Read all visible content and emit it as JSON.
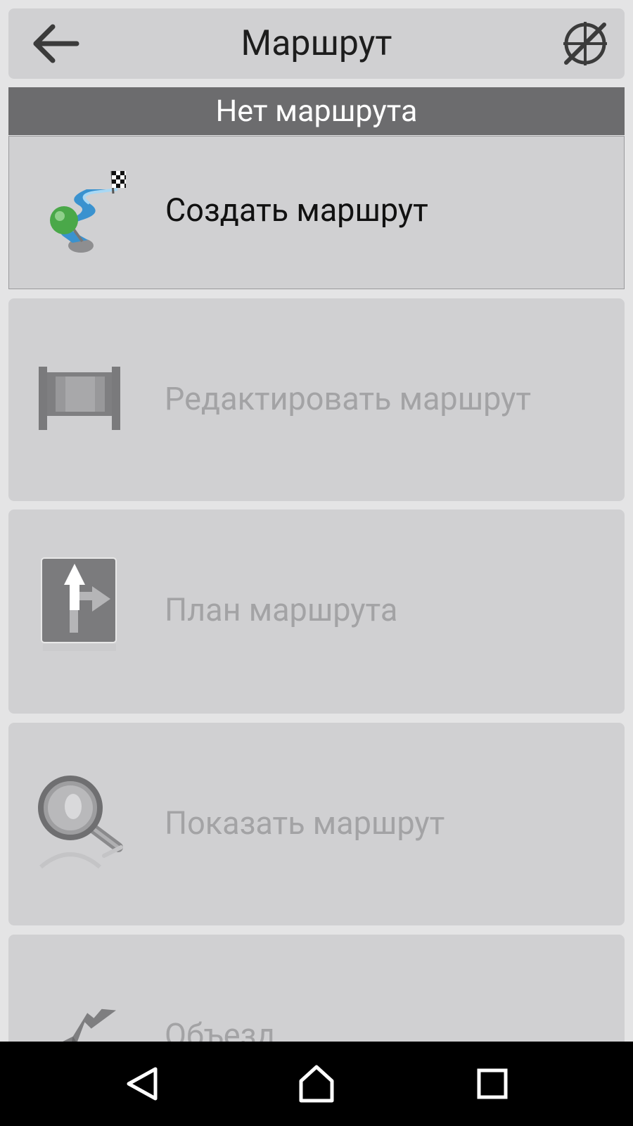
{
  "header": {
    "title": "Маршрут",
    "back_icon": "arrow-left-icon",
    "right_icon": "gps-off-icon"
  },
  "status": {
    "text": "Нет маршрута"
  },
  "menu": {
    "items": [
      {
        "label": "Создать маршрут",
        "icon": "create-route-icon",
        "enabled": true
      },
      {
        "label": "Редактировать маршрут",
        "icon": "edit-route-icon",
        "enabled": false
      },
      {
        "label": "План маршрута",
        "icon": "route-plan-icon",
        "enabled": false
      },
      {
        "label": "Показать маршрут",
        "icon": "magnifier-icon",
        "enabled": false
      },
      {
        "label": "Объезд",
        "icon": "detour-icon",
        "enabled": false
      }
    ]
  },
  "navbar": {
    "back_icon": "nav-back-icon",
    "home_icon": "nav-home-icon",
    "recents_icon": "nav-recents-icon"
  },
  "colors": {
    "background": "#e4e4e5",
    "card": "#d0d0d2",
    "status_bar": "#6c6c6e",
    "disabled_text": "#a3a3a5",
    "navbar": "#000000"
  }
}
